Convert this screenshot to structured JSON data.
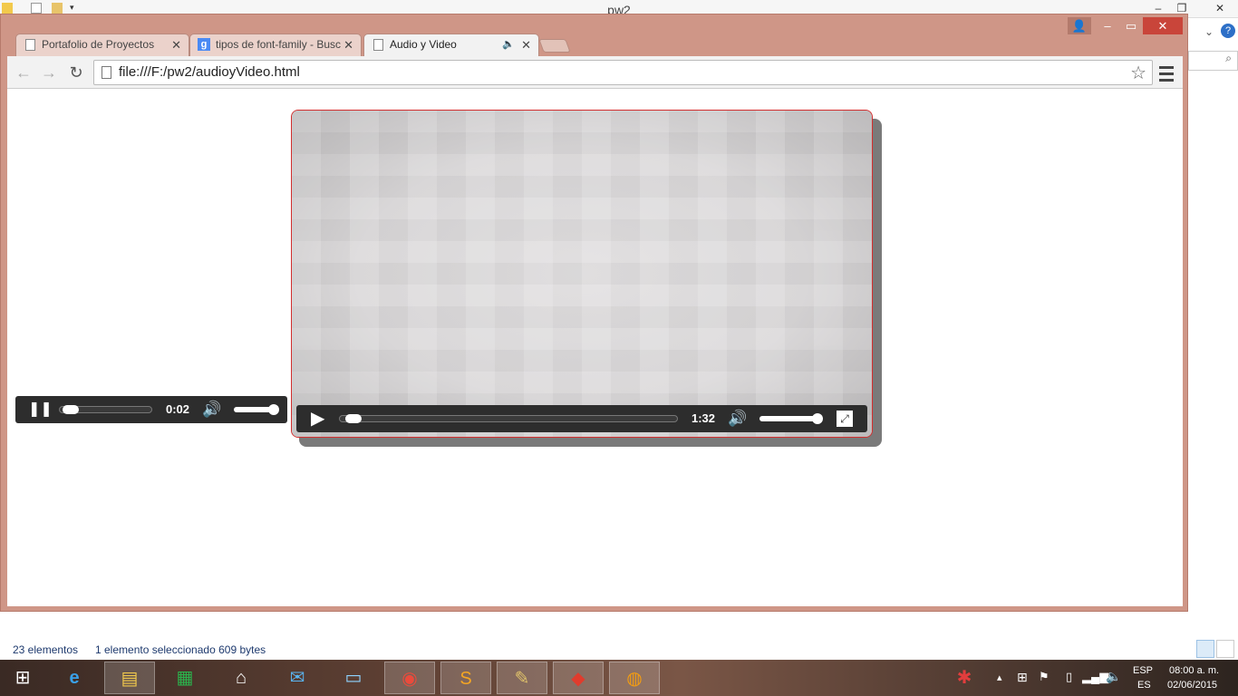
{
  "explorer": {
    "title": "pw2",
    "status_count": "23 elementos",
    "status_selection": "1 elemento seleccionado  609 bytes"
  },
  "browser": {
    "tabs": [
      {
        "label": "Portafolio de Proyectos",
        "active": false,
        "favicon": "page-icon"
      },
      {
        "label": "tipos de font-family - Busc",
        "active": false,
        "favicon": "google-icon"
      },
      {
        "label": "Audio y Video",
        "active": true,
        "favicon": "page-icon",
        "audio_indicator": "speaker-icon"
      }
    ],
    "url": "file:///F:/pw2/audioyVideo.html"
  },
  "audio_player": {
    "time": "0:02",
    "progress": 0.05,
    "volume": 1.0,
    "state": "playing"
  },
  "video_player": {
    "time": "1:32",
    "progress": 0.02,
    "volume": 1.0,
    "state": "paused"
  },
  "taskbar": {
    "items": [
      "start-icon",
      "internet-explorer-icon",
      "file-explorer-icon",
      "store-icon",
      "home-icon",
      "mail-icon",
      "lenovo-icon",
      "chrome-icon",
      "sublime-text-icon",
      "paint-icon",
      "app-icon",
      "firefox-icon"
    ],
    "language": "ESP",
    "layout": "ES",
    "time": "08:00 a. m.",
    "date": "02/06/2015"
  }
}
